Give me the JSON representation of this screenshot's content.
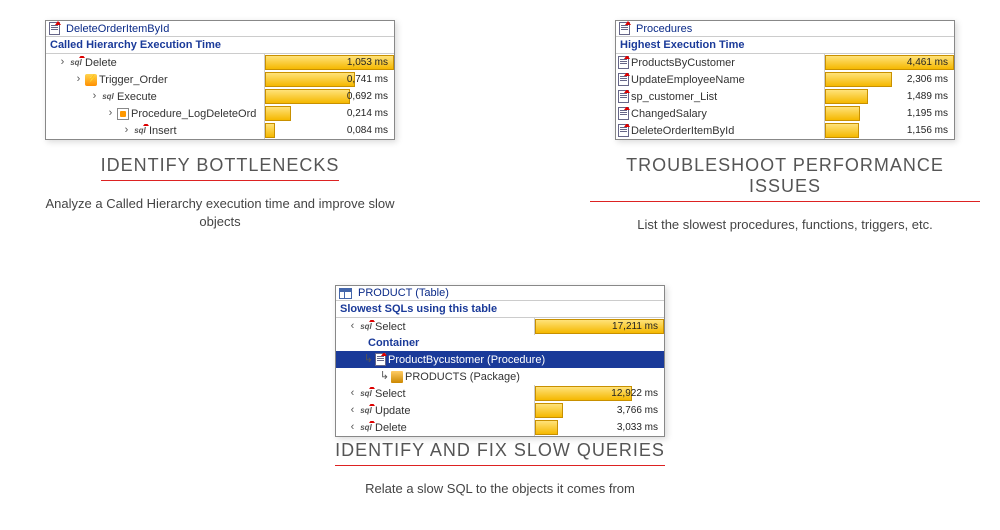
{
  "left_panel": {
    "title": "DeleteOrderItemById",
    "subtitle": "Called Hierarchy Execution Time",
    "rows": [
      {
        "indent": 1,
        "icon": "sql-red",
        "toggle": "›",
        "label": "Delete",
        "ms": "1,053 ms",
        "pct": 100
      },
      {
        "indent": 2,
        "icon": "trigger",
        "toggle": "›",
        "label": "Trigger_Order",
        "ms": "0,741 ms",
        "pct": 70
      },
      {
        "indent": 3,
        "icon": "sql",
        "toggle": "›",
        "label": "Execute",
        "ms": "0,692 ms",
        "pct": 66
      },
      {
        "indent": 4,
        "icon": "proc",
        "toggle": "›",
        "label": "Procedure_LogDeleteOrd",
        "ms": "0,214 ms",
        "pct": 20
      },
      {
        "indent": 5,
        "icon": "sql-red",
        "toggle": "›",
        "label": "Insert",
        "ms": "0,084 ms",
        "pct": 8
      }
    ]
  },
  "right_panel": {
    "title": "Procedures",
    "subtitle": "Highest Execution Time",
    "rows": [
      {
        "icon": "doc",
        "label": "ProductsByCustomer",
        "ms": "4,461 ms",
        "pct": 100
      },
      {
        "icon": "doc",
        "label": "UpdateEmployeeName",
        "ms": "2,306 ms",
        "pct": 52
      },
      {
        "icon": "doc",
        "label": "sp_customer_List",
        "ms": "1,489 ms",
        "pct": 33
      },
      {
        "icon": "doc",
        "label": "ChangedSalary",
        "ms": "1,195 ms",
        "pct": 27
      },
      {
        "icon": "doc",
        "label": "DeleteOrderItemById",
        "ms": "1,156 ms",
        "pct": 26
      }
    ]
  },
  "bottom_panel": {
    "title": "PRODUCT (Table)",
    "subtitle": "Slowest SQLs using this table",
    "top_row": {
      "indent": 1,
      "icon": "sql-red",
      "toggle": "‹",
      "label": "Select",
      "ms": "17,211 ms",
      "pct": 100
    },
    "container_label": "Container",
    "selected_row": {
      "indent": 2,
      "icon": "doc",
      "toggle": "↳",
      "label": "ProductBycustomer (Procedure)"
    },
    "pkg_row": {
      "indent": 3,
      "icon": "pkg",
      "toggle": "↳",
      "label": "PRODUCTS (Package)"
    },
    "rows": [
      {
        "indent": 1,
        "icon": "sql-red",
        "toggle": "‹",
        "label": "Select",
        "ms": "12,922 ms",
        "pct": 75
      },
      {
        "indent": 1,
        "icon": "sql-red",
        "toggle": "‹",
        "label": "Update",
        "ms": "3,766 ms",
        "pct": 22
      },
      {
        "indent": 1,
        "icon": "sql-red",
        "toggle": "‹",
        "label": "Delete",
        "ms": "3,033 ms",
        "pct": 18
      }
    ]
  },
  "captions": {
    "left": {
      "title": "IDENTIFY BOTTLENECKS",
      "sub": "Analyze a Called Hierarchy execution time and improve slow objects"
    },
    "right": {
      "title": "TROUBLESHOOT PERFORMANCE ISSUES",
      "sub": "List the slowest procedures, functions, triggers, etc."
    },
    "bottom": {
      "title": "IDENTIFY AND FIX SLOW QUERIES",
      "sub": "Relate a slow SQL to the objects it comes from"
    }
  }
}
